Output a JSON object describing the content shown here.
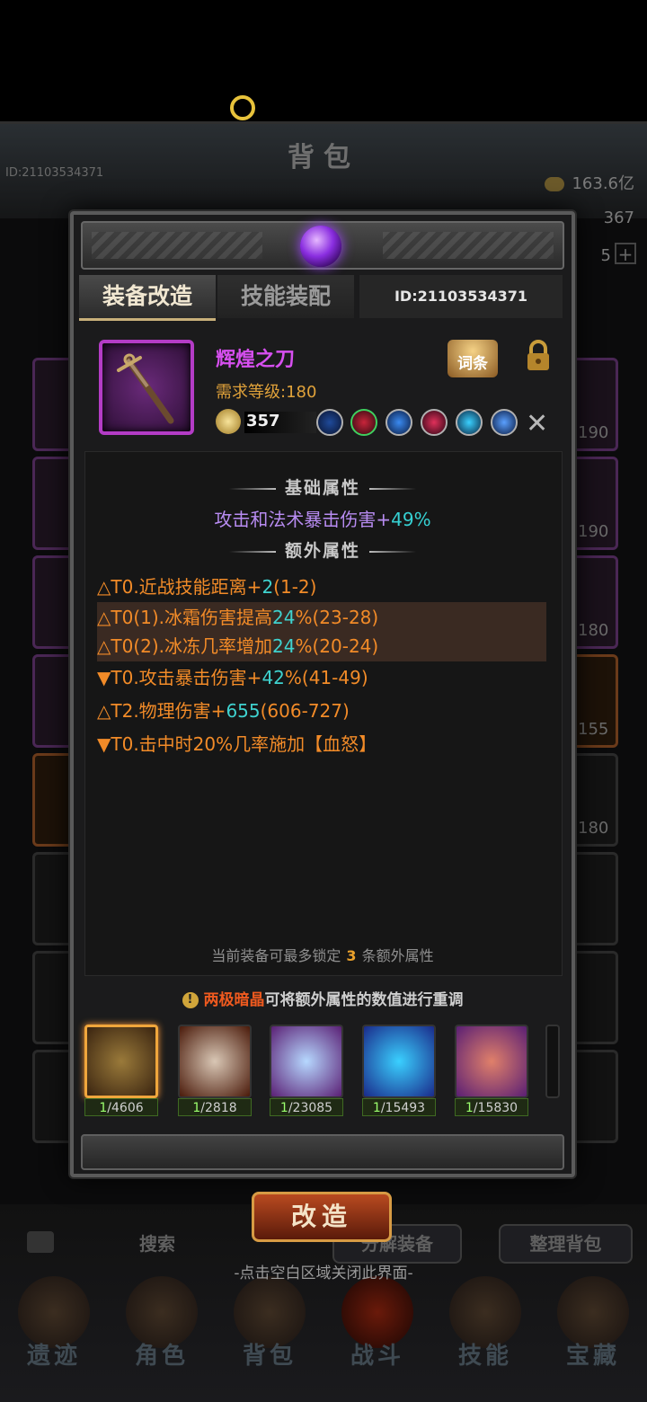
{
  "background": {
    "bag_title": "背包",
    "player_id": "ID:21103534371",
    "currency_gold": "163.6亿",
    "currency_2": "367",
    "currency_3": "5",
    "side_levels_right": [
      "190",
      "190",
      "180",
      "155",
      "180"
    ],
    "search_label": "搜索",
    "decompose_label": "分解装备",
    "sort_label": "整理背包",
    "nav": [
      "遗迹",
      "角色",
      "背包",
      "战斗",
      "技能",
      "宝藏"
    ],
    "close_hint": "-点击空白区域关闭此界面-"
  },
  "modal": {
    "tabs": [
      "装备改造",
      "技能装配"
    ],
    "id_label": "ID:21103534371",
    "item": {
      "name": "辉煌之刀",
      "required_level": "需求等级:180",
      "power": "357",
      "affix_button": "词条"
    },
    "base_title": "基础属性",
    "base_stat_text": "攻击和法术暴击伤害+",
    "base_stat_value": "49%",
    "extra_title": "额外属性",
    "extras": [
      {
        "pre": "△T0.近战技能距离+",
        "num": "2",
        "post": "(1-2)"
      },
      {
        "pre": "△T0(1).冰霜伤害提高",
        "num": "24",
        "post": "%(23-28)"
      },
      {
        "pre": "△T0(2).冰冻几率增加",
        "num": "24",
        "post": "%(20-24)"
      },
      {
        "pre": "▼T0.攻击暴击伤害+",
        "num": "42",
        "post": "%(41-49)"
      },
      {
        "pre": "△T2.物理伤害+",
        "num": "655",
        "post": "(606-727)"
      },
      {
        "pre": "▼T0.击中时20%几率施加【血怒】",
        "num": "",
        "post": ""
      }
    ],
    "lock_note_pre": "当前装备可最多锁定",
    "lock_note_num": "3",
    "lock_note_post": "条额外属性",
    "tip_highlight": "两极暗晶",
    "tip_text": "可将额外属性的数值进行重调",
    "materials": [
      {
        "owned": "1",
        "total": "/4606"
      },
      {
        "owned": "1",
        "total": "/2818"
      },
      {
        "owned": "1",
        "total": "/23085"
      },
      {
        "owned": "1",
        "total": "/15493"
      },
      {
        "owned": "1",
        "total": "/15830"
      }
    ],
    "remake_button": "改造"
  }
}
